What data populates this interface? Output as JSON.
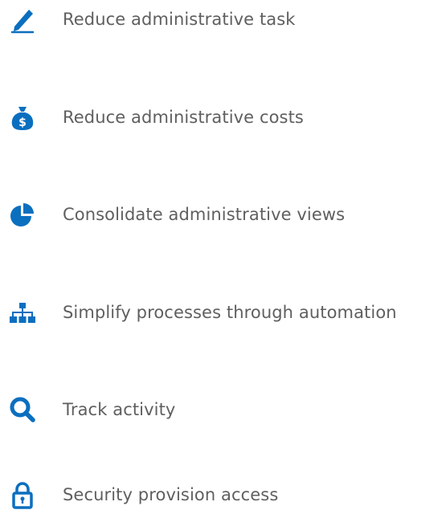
{
  "colors": {
    "accent": "#0b6fbf",
    "text": "#5f5f5f",
    "background": "#ffffff"
  },
  "benefits": [
    {
      "icon": "pen-icon",
      "label": "Reduce administrative task"
    },
    {
      "icon": "money-bag-icon",
      "label": "Reduce administrative costs"
    },
    {
      "icon": "pie-chart-icon",
      "label": "Consolidate administrative views"
    },
    {
      "icon": "org-chart-icon",
      "label": "Simplify processes through automation"
    },
    {
      "icon": "search-icon",
      "label": "Track activity"
    },
    {
      "icon": "lock-icon",
      "label": "Security provision access"
    }
  ]
}
